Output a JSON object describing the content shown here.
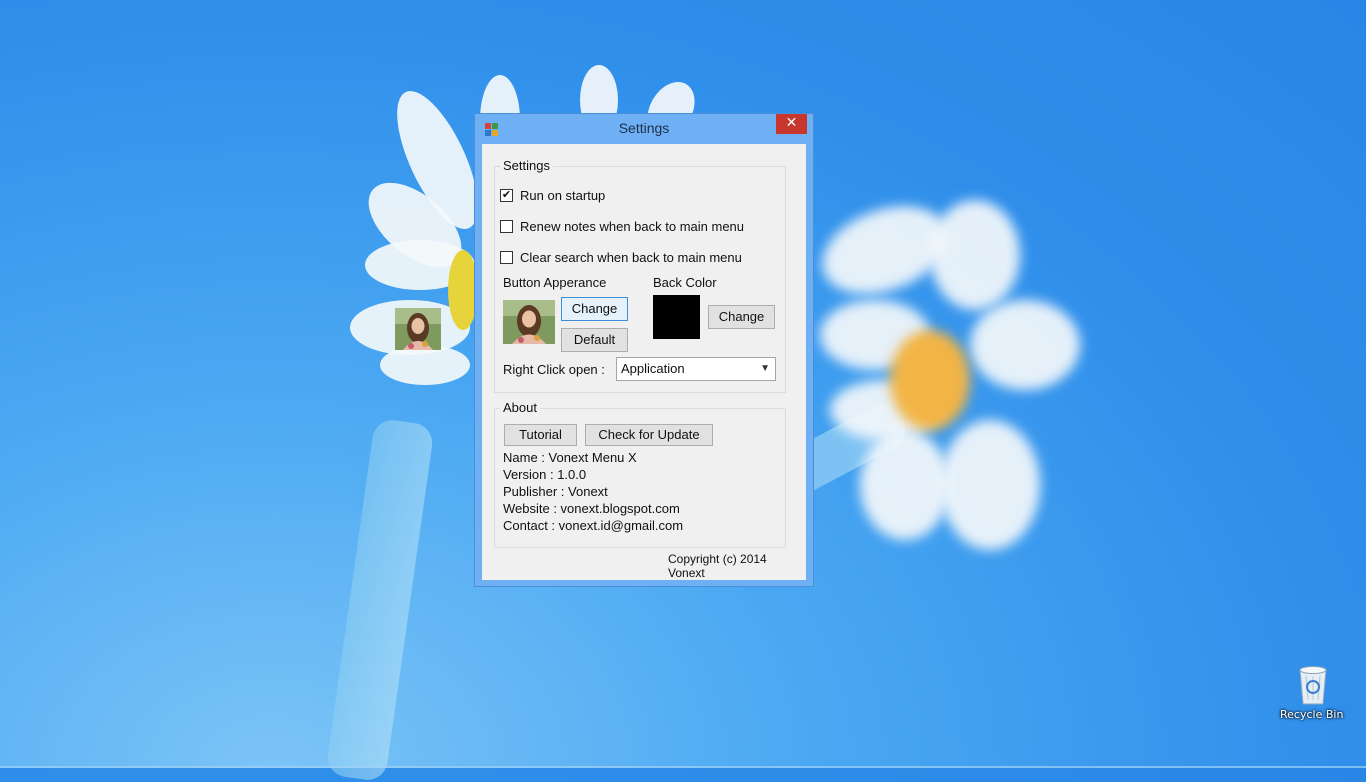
{
  "desktop": {
    "recycle_bin_label": "Recycle Bin",
    "avatar_icon": "woman-portrait-icon"
  },
  "window": {
    "title": "Settings",
    "close_glyph": "✕",
    "app_icon": "vonext-menu-app-icon",
    "settings_group": {
      "title": "Settings",
      "options": [
        {
          "label": "Run on startup",
          "checked": true
        },
        {
          "label": "Renew notes when back to main menu",
          "checked": false
        },
        {
          "label": "Clear search when back to main menu",
          "checked": false
        }
      ],
      "button_appearance_label": "Button Apperance",
      "change_label": "Change",
      "default_label": "Default",
      "back_color_label": "Back Color",
      "back_color_change_label": "Change",
      "back_color_value": "#000000",
      "right_click_label": "Right Click open :",
      "right_click_value": "Application"
    },
    "about_group": {
      "title": "About",
      "tutorial_label": "Tutorial",
      "update_label": "Check for Update",
      "lines": [
        "Name : Vonext Menu X",
        "Version : 1.0.0",
        "Publisher : Vonext",
        "Website : vonext.blogspot.com",
        "Contact : vonext.id@gmail.com"
      ]
    },
    "copyright": "Copyright (c) 2014 Vonext"
  }
}
